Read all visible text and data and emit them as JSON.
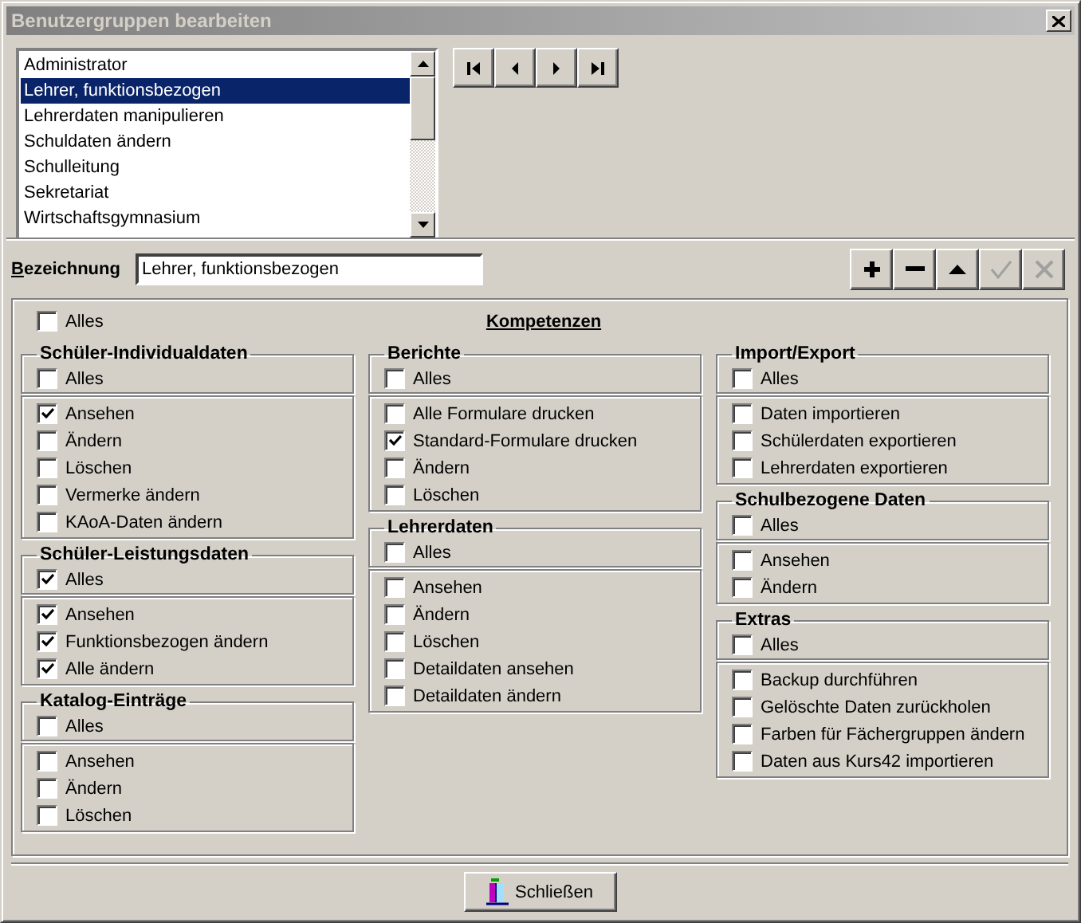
{
  "window": {
    "title": "Benutzergruppen bearbeiten"
  },
  "groups_list": {
    "items": [
      {
        "label": "Administrator",
        "selected": false
      },
      {
        "label": "Lehrer, funktionsbezogen",
        "selected": true
      },
      {
        "label": "Lehrerdaten manipulieren",
        "selected": false
      },
      {
        "label": "Schuldaten ändern",
        "selected": false
      },
      {
        "label": "Schulleitung",
        "selected": false
      },
      {
        "label": "Sekretariat",
        "selected": false
      },
      {
        "label": "Wirtschaftsgymnasium",
        "selected": false
      }
    ]
  },
  "navigation": [
    {
      "kind": "first"
    },
    {
      "kind": "previous"
    },
    {
      "kind": "next"
    },
    {
      "kind": "last"
    }
  ],
  "name_field": {
    "label": "Bezeichnung",
    "value": "Lehrer, funktionsbezogen"
  },
  "toolbar": [
    {
      "kind": "add",
      "disabled": false
    },
    {
      "kind": "remove",
      "disabled": false
    },
    {
      "kind": "up",
      "disabled": false
    },
    {
      "kind": "confirm",
      "disabled": true
    },
    {
      "kind": "cancel",
      "disabled": true
    }
  ],
  "competences": {
    "all": {
      "label": "Alles",
      "checked": false
    },
    "title": "Kompetenzen",
    "columns": [
      [
        {
          "title": "Schüler-Individualdaten",
          "all": {
            "label": "Alles",
            "checked": false
          },
          "items": [
            {
              "label": "Ansehen",
              "checked": true
            },
            {
              "label": "Ändern",
              "checked": false
            },
            {
              "label": "Löschen",
              "checked": false
            },
            {
              "label": "Vermerke ändern",
              "checked": false
            },
            {
              "label": "KAoA-Daten ändern",
              "checked": false
            }
          ]
        },
        {
          "title": "Schüler-Leistungsdaten",
          "all": {
            "label": "Alles",
            "checked": true
          },
          "items": [
            {
              "label": "Ansehen",
              "checked": true
            },
            {
              "label": "Funktionsbezogen ändern",
              "checked": true
            },
            {
              "label": "Alle ändern",
              "checked": true
            }
          ]
        },
        {
          "title": "Katalog-Einträge",
          "all": {
            "label": "Alles",
            "checked": false
          },
          "items": [
            {
              "label": "Ansehen",
              "checked": false
            },
            {
              "label": "Ändern",
              "checked": false
            },
            {
              "label": "Löschen",
              "checked": false
            }
          ]
        }
      ],
      [
        {
          "title": "Berichte",
          "all": {
            "label": "Alles",
            "checked": false
          },
          "items": [
            {
              "label": "Alle Formulare drucken",
              "checked": false
            },
            {
              "label": "Standard-Formulare drucken",
              "checked": true
            },
            {
              "label": "Ändern",
              "checked": false
            },
            {
              "label": "Löschen",
              "checked": false
            }
          ]
        },
        {
          "title": "Lehrerdaten",
          "all": {
            "label": "Alles",
            "checked": false
          },
          "items": [
            {
              "label": "Ansehen",
              "checked": false
            },
            {
              "label": "Ändern",
              "checked": false
            },
            {
              "label": "Löschen",
              "checked": false
            },
            {
              "label": "Detaildaten ansehen",
              "checked": false
            },
            {
              "label": "Detaildaten ändern",
              "checked": false
            }
          ]
        }
      ],
      [
        {
          "title": "Import/Export",
          "all": {
            "label": "Alles",
            "checked": false
          },
          "items": [
            {
              "label": "Daten importieren",
              "checked": false
            },
            {
              "label": "Schülerdaten exportieren",
              "checked": false
            },
            {
              "label": "Lehrerdaten exportieren",
              "checked": false
            }
          ]
        },
        {
          "title": "Schulbezogene Daten",
          "all": {
            "label": "Alles",
            "checked": false
          },
          "items": [
            {
              "label": "Ansehen",
              "checked": false
            },
            {
              "label": "Ändern",
              "checked": false
            }
          ]
        },
        {
          "title": "Extras",
          "all": {
            "label": "Alles",
            "checked": false
          },
          "items": [
            {
              "label": "Backup durchführen",
              "checked": false
            },
            {
              "label": "Gelöschte Daten zurückholen",
              "checked": false
            },
            {
              "label": "Farben für Fächergruppen ändern",
              "checked": false
            },
            {
              "label": "Daten aus Kurs42 importieren",
              "checked": false
            }
          ]
        }
      ]
    ]
  },
  "close_button": {
    "label": "Schließen"
  }
}
